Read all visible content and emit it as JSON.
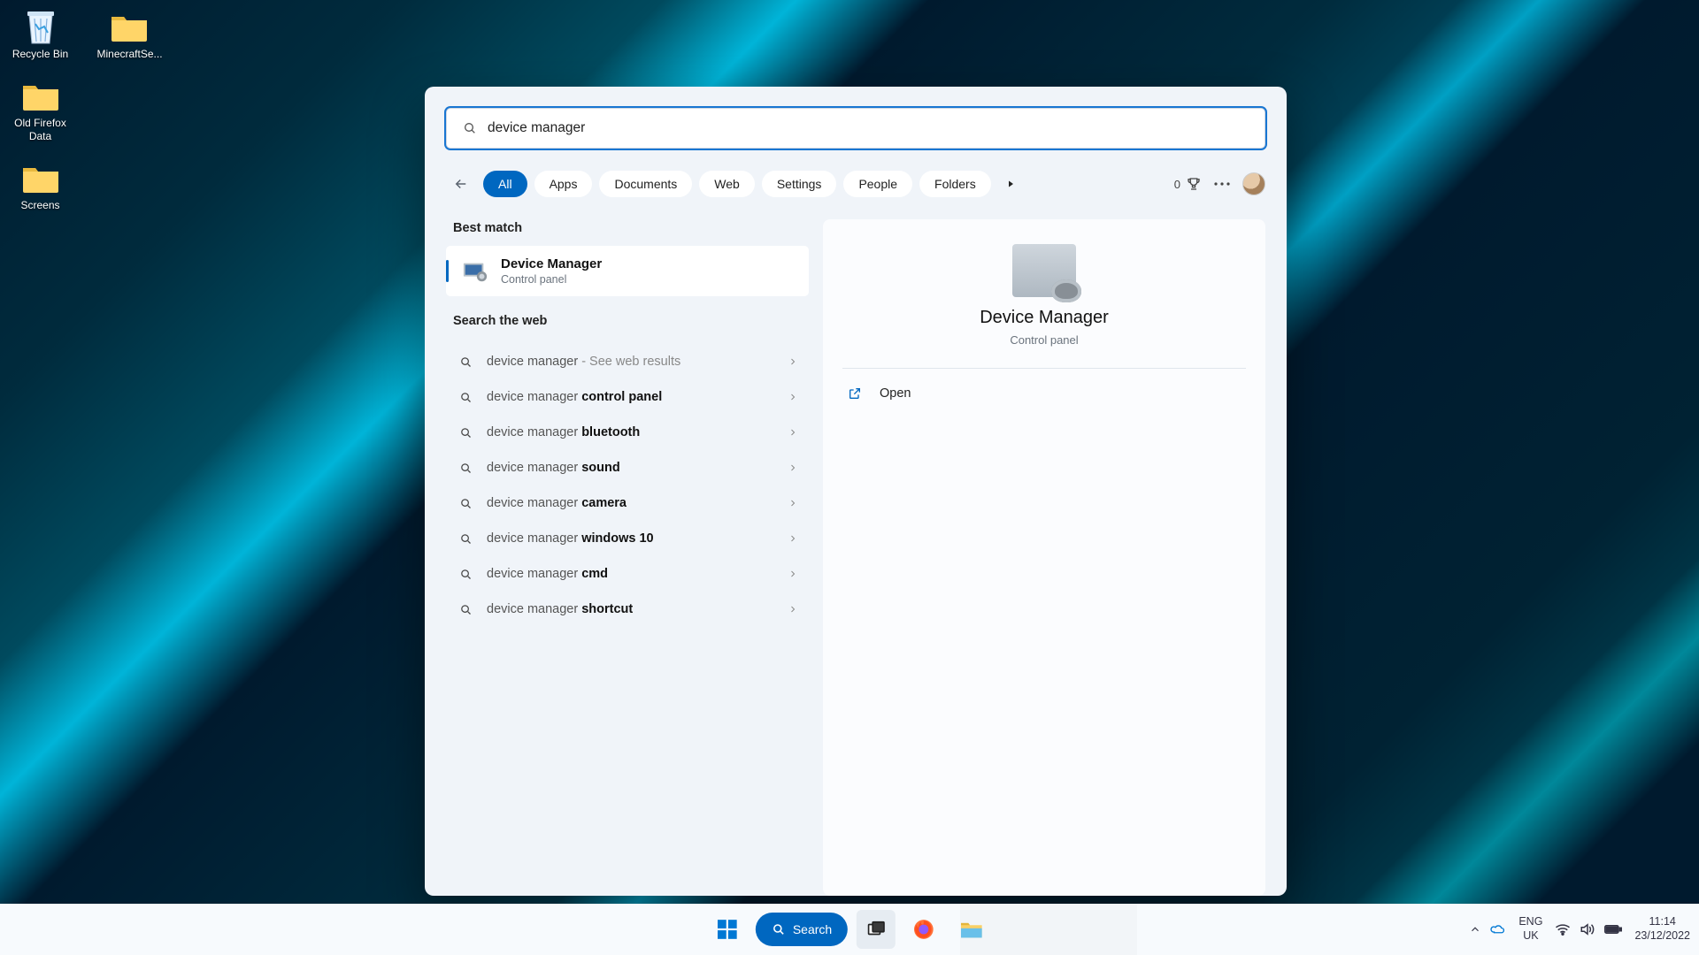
{
  "desktop": {
    "icons": [
      {
        "name": "recycle-bin",
        "label": "Recycle Bin",
        "kind": "bin"
      },
      {
        "name": "minecraft-server",
        "label": "MinecraftSe...",
        "kind": "folder"
      },
      {
        "name": "old-firefox-data",
        "label": "Old Firefox Data",
        "kind": "folder"
      },
      {
        "name": "screens",
        "label": "Screens",
        "kind": "folder"
      }
    ]
  },
  "search": {
    "query": "device manager",
    "filters": [
      "All",
      "Apps",
      "Documents",
      "Web",
      "Settings",
      "People",
      "Folders"
    ],
    "active_filter": 0,
    "reward_count": "0",
    "sections": {
      "best_match_label": "Best match",
      "search_web_label": "Search the web"
    },
    "best_match": {
      "title": "Device Manager",
      "subtitle": "Control panel"
    },
    "web_results": [
      {
        "base": "device manager",
        "bold": "",
        "hint": " - See web results"
      },
      {
        "base": "device manager ",
        "bold": "control panel",
        "hint": ""
      },
      {
        "base": "device manager ",
        "bold": "bluetooth",
        "hint": ""
      },
      {
        "base": "device manager ",
        "bold": "sound",
        "hint": ""
      },
      {
        "base": "device manager ",
        "bold": "camera",
        "hint": ""
      },
      {
        "base": "device manager ",
        "bold": "windows 10",
        "hint": ""
      },
      {
        "base": "device manager ",
        "bold": "cmd",
        "hint": ""
      },
      {
        "base": "device manager ",
        "bold": "shortcut",
        "hint": ""
      }
    ],
    "preview": {
      "title": "Device Manager",
      "subtitle": "Control panel",
      "open_label": "Open"
    }
  },
  "taskbar": {
    "search_label": "Search",
    "tray": {
      "lang1": "ENG",
      "lang2": "UK",
      "time": "11:14",
      "date": "23/12/2022"
    }
  }
}
